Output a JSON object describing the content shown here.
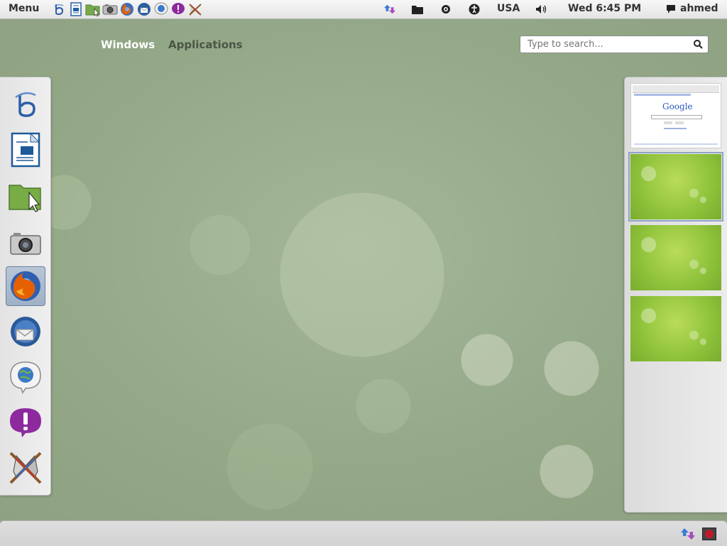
{
  "top_panel": {
    "menu_label": "Menu",
    "launchers": [
      {
        "name": "bluefish-launcher",
        "icon": "bluefish-icon"
      },
      {
        "name": "writer-launcher",
        "icon": "document-icon"
      },
      {
        "name": "files-launcher",
        "icon": "folder-icon"
      },
      {
        "name": "camera-launcher",
        "icon": "camera-icon"
      },
      {
        "name": "firefox-launcher",
        "icon": "firefox-icon"
      },
      {
        "name": "thunderbird-launcher",
        "icon": "thunderbird-icon"
      },
      {
        "name": "chat-launcher",
        "icon": "chat-globe-icon"
      },
      {
        "name": "alert-launcher",
        "icon": "exclamation-bubble-icon"
      },
      {
        "name": "game-launcher",
        "icon": "crossed-swords-icon"
      }
    ],
    "keyboard_layout": "USA",
    "clock": "Wed  6:45 PM",
    "user_name": "ahmed"
  },
  "overview": {
    "tab_windows": "Windows",
    "tab_applications": "Applications",
    "search_placeholder": "Type to search..."
  },
  "dash": {
    "items": [
      {
        "name": "bluefish",
        "icon": "bluefish-icon",
        "active": false
      },
      {
        "name": "libreoffice-writer",
        "icon": "document-icon",
        "active": false
      },
      {
        "name": "file-manager",
        "icon": "folder-icon",
        "active": false
      },
      {
        "name": "camera",
        "icon": "camera-icon",
        "active": false
      },
      {
        "name": "firefox",
        "icon": "firefox-icon",
        "active": true
      },
      {
        "name": "thunderbird",
        "icon": "thunderbird-icon",
        "active": false
      },
      {
        "name": "chat",
        "icon": "chat-globe-icon",
        "active": false
      },
      {
        "name": "alert",
        "icon": "exclamation-bubble-icon",
        "active": false
      },
      {
        "name": "game",
        "icon": "crossed-swords-icon",
        "active": false
      }
    ]
  },
  "workspaces": {
    "items": [
      {
        "name": "workspace-1",
        "content": "browser-window",
        "logo_text": "Google"
      },
      {
        "name": "workspace-2",
        "content": "empty",
        "active": true
      },
      {
        "name": "workspace-3",
        "content": "empty"
      },
      {
        "name": "workspace-4",
        "content": "empty"
      }
    ]
  },
  "colors": {
    "desktop_green": "#9aac8e",
    "panel_bg": "#eeeeee",
    "active_highlight": "#8fa4c4",
    "firefox_orange": "#e66000",
    "chat_purple": "#8c2a9e"
  }
}
